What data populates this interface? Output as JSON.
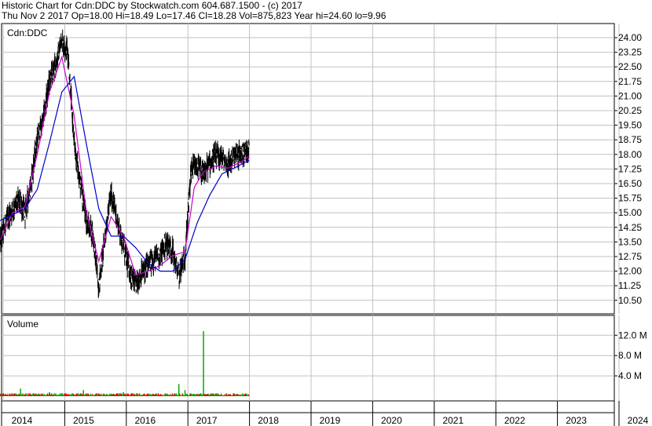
{
  "header": {
    "line1": "Historic Chart for Cdn:DDC by Stockwatch.com 604.687.1500 - (c) 2017",
    "line2": "Thu Nov  2 2017   Op=18.00   Hi=18.49   Lo=17.46   Cl=18.28   Vol=875,823   Year hi=24.60   lo=9.96"
  },
  "colors": {
    "background": "#ffffff",
    "grid": "#c0c0c0",
    "price_bars": "#000000",
    "short_ma": "#cc00cc",
    "long_ma": "#0000cc",
    "volume_up": "#00aa00",
    "volume_down": "#dd0000"
  },
  "chart_data": [
    {
      "type": "line",
      "label": "Cdn:DDC",
      "ylim": [
        10.0,
        24.4
      ],
      "y_ticks": [
        "24.00",
        "23.25",
        "22.50",
        "21.75",
        "21.00",
        "20.25",
        "19.50",
        "18.75",
        "18.00",
        "17.25",
        "16.50",
        "15.75",
        "15.00",
        "14.25",
        "13.50",
        "12.75",
        "12.00",
        "11.25",
        "10.50"
      ],
      "x_ticks": [
        "2014",
        "2015",
        "2016",
        "2017",
        "2018",
        "2019",
        "2020",
        "2021",
        "2022",
        "2023",
        "2024"
      ],
      "grid": true,
      "series": [
        {
          "kind": "price_range",
          "x": [
            2013.8,
            2013.9,
            2014.0,
            2014.1,
            2014.2,
            2014.3,
            2014.4,
            2014.5,
            2014.6,
            2014.7,
            2014.8,
            2014.9,
            2015.0,
            2015.1,
            2015.2,
            2015.3,
            2015.4,
            2015.5,
            2015.6,
            2015.7,
            2015.8,
            2015.9,
            2016.0,
            2016.1,
            2016.2,
            2016.3,
            2016.4,
            2016.5,
            2016.6,
            2016.7,
            2016.8,
            2016.9,
            2017.0,
            2017.1,
            2017.2,
            2017.3,
            2017.4,
            2017.5,
            2017.6,
            2017.7,
            2017.84
          ],
          "close": [
            13.5,
            14.6,
            15.2,
            15.6,
            15.0,
            16.5,
            18.8,
            19.8,
            21.8,
            22.6,
            23.9,
            23.2,
            18.5,
            16.5,
            14.5,
            14.0,
            11.2,
            13.8,
            16.0,
            14.6,
            13.3,
            12.0,
            11.3,
            11.9,
            12.3,
            12.6,
            12.9,
            13.4,
            13.0,
            11.7,
            12.8,
            17.2,
            17.4,
            16.9,
            17.6,
            17.9,
            17.8,
            17.5,
            17.9,
            18.0,
            18.28
          ]
        },
        {
          "name": "",
          "kind": "short_ma",
          "x": [
            2013.8,
            2014.0,
            2014.2,
            2014.4,
            2014.6,
            2014.8,
            2015.0,
            2015.2,
            2015.4,
            2015.6,
            2015.8,
            2016.0,
            2016.2,
            2016.4,
            2016.6,
            2016.8,
            2016.95,
            2017.1,
            2017.3,
            2017.5,
            2017.7,
            2017.84
          ],
          "values": [
            13.6,
            15.0,
            15.3,
            18.0,
            21.2,
            23.0,
            20.0,
            15.0,
            12.5,
            14.8,
            13.8,
            11.8,
            12.0,
            12.3,
            12.8,
            13.0,
            16.3,
            17.1,
            17.4,
            17.3,
            17.6,
            17.9
          ]
        },
        {
          "name": "",
          "kind": "long_ma",
          "x": [
            2013.8,
            2014.0,
            2014.2,
            2014.4,
            2014.6,
            2014.8,
            2015.0,
            2015.2,
            2015.4,
            2015.6,
            2015.8,
            2016.0,
            2016.2,
            2016.4,
            2016.6,
            2016.8,
            2017.0,
            2017.2,
            2017.4,
            2017.6,
            2017.84
          ],
          "values": [
            14.6,
            14.9,
            15.2,
            16.2,
            18.6,
            21.2,
            22.0,
            18.5,
            15.2,
            13.8,
            13.8,
            13.2,
            12.4,
            12.0,
            12.0,
            12.6,
            14.5,
            15.9,
            17.0,
            17.3,
            17.7
          ]
        }
      ]
    },
    {
      "type": "bar",
      "label": "Volume",
      "ylim": [
        0,
        14.5
      ],
      "y_ticks": [
        "12.0 M",
        "8.0 M",
        "4.0 M"
      ],
      "grid": true,
      "spikes": [
        {
          "x": 2014.13,
          "value": 1.5
        },
        {
          "x": 2014.6,
          "value": 0.8
        },
        {
          "x": 2015.15,
          "value": 1.2
        },
        {
          "x": 2015.8,
          "value": 0.8
        },
        {
          "x": 2016.7,
          "value": 2.4
        },
        {
          "x": 2016.8,
          "value": 1.2
        },
        {
          "x": 2017.1,
          "value": 12.8
        }
      ]
    }
  ]
}
